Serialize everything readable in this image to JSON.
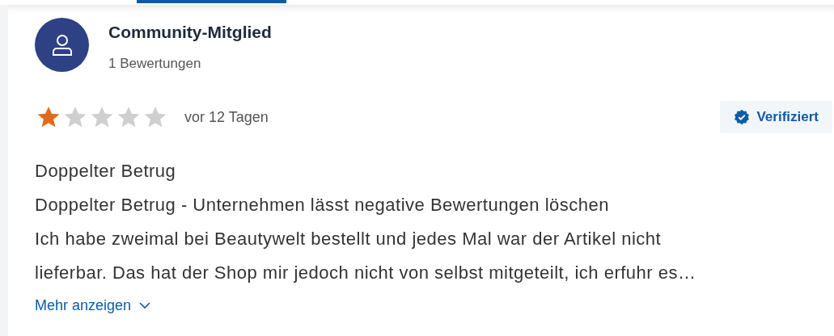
{
  "author": {
    "name": "Community-Mitglied",
    "review_count": "1 Bewertungen"
  },
  "rating": {
    "stars": 1
  },
  "date": "vor 12 Tagen",
  "badge": {
    "label": "Verifiziert"
  },
  "review": {
    "title": "Doppelter Betrug",
    "headline": "Doppelter Betrug - Unternehmen lässt negative Bewertungen löschen",
    "body": "Ich habe zweimal bei Beautywelt bestellt und jedes Mal war der Artikel nicht lieferbar. Das hat der Shop mir jedoch nicht von selbst mitgeteilt, ich erfuhr es…"
  },
  "more_link": "Mehr anzeigen"
}
